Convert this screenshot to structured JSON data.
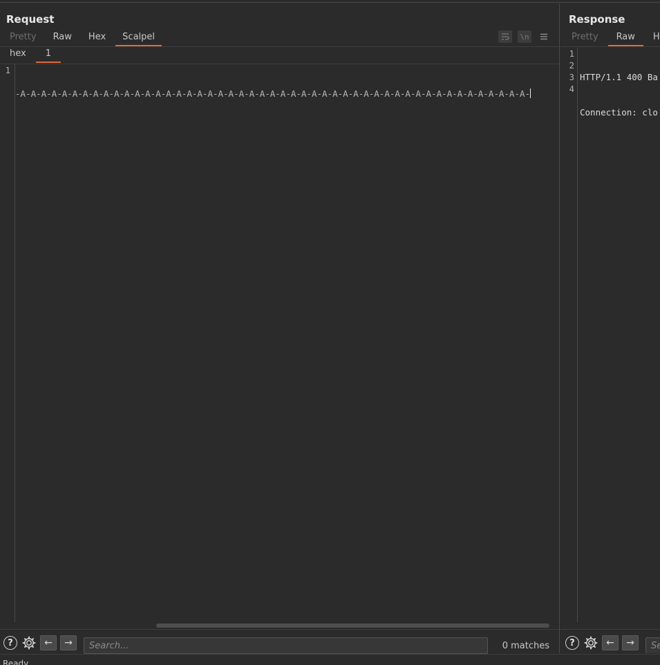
{
  "request": {
    "title": "Request",
    "tabs": [
      {
        "label": "Pretty",
        "state": "disabled"
      },
      {
        "label": "Raw",
        "state": "normal"
      },
      {
        "label": "Hex",
        "state": "normal"
      },
      {
        "label": "Scalpel",
        "state": "active"
      }
    ],
    "tools": {
      "wrap_icon": "word-wrap-icon",
      "newline_label": "\\n",
      "menu_icon": "hamburger-menu-icon"
    },
    "subtabs": [
      {
        "label": "hex",
        "active": false
      },
      {
        "label": "1",
        "active": true
      }
    ],
    "editor": {
      "line_numbers": [
        "1"
      ],
      "lines": [
        "-A-A-A-A-A-A-A-A-A-A-A-A-A-A-A-A-A-A-A-A-A-A-A-A-A-A-A-A-A-A-A-A-A-A-A-A-A-A-A-A-A-A-A-A-A-A-A-A-A-"
      ]
    },
    "search": {
      "placeholder": "Search...",
      "matches": "0 matches"
    }
  },
  "response": {
    "title": "Response",
    "tabs": [
      {
        "label": "Pretty",
        "state": "disabled"
      },
      {
        "label": "Raw",
        "state": "active"
      },
      {
        "label": "H",
        "state": "normal"
      }
    ],
    "editor": {
      "line_numbers": [
        "1",
        "2",
        "3",
        "4"
      ],
      "lines": [
        "HTTP/1.1 400 Ba",
        "Connection: clo",
        "",
        ""
      ]
    },
    "search": {
      "placeholder": "Se"
    }
  },
  "status": {
    "text": "Ready"
  },
  "colors": {
    "accent": "#e0693a",
    "background": "#2b2b2b"
  }
}
